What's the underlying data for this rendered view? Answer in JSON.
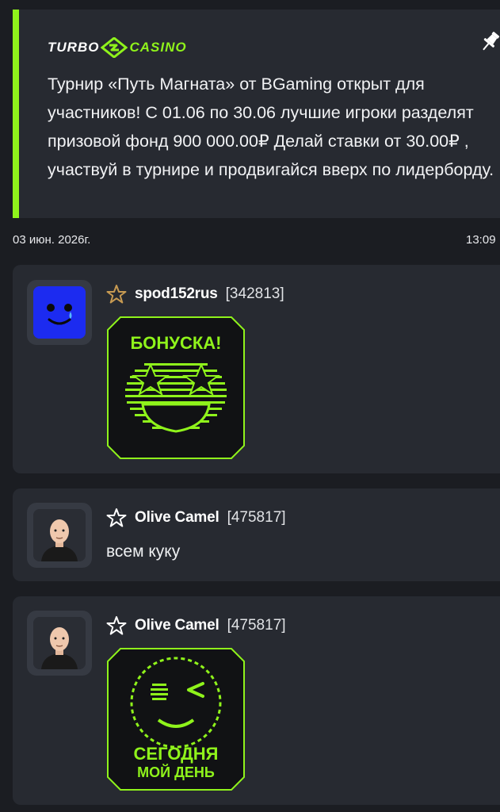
{
  "pinned": {
    "logo_left": "TURBO",
    "logo_right": "CASINO",
    "text": "Турнир «Путь Магната» от BGaming открыт для участников! С 01.06 по 30.06 лучшие игроки разделят призовой фонд 900 000.00₽ Делай ставки от 30.00₽ , участвуй в турнире и продвигайся вверх по лидерборду.",
    "pin_icon": "pin-icon"
  },
  "meta": {
    "date": "03 июн. 2026г.",
    "time": "13:09"
  },
  "messages": [
    {
      "username": "spod152rus",
      "user_id": "[342813]",
      "star_color": "#c79a52",
      "sticker_text": "БОНУСКА!"
    },
    {
      "username": "Olive Camel",
      "user_id": "[475817]",
      "text": "всем куку"
    },
    {
      "username": "Olive Camel",
      "user_id": "[475817]",
      "sticker_line1": "СЕГОДНЯ",
      "sticker_line2": "МОЙ ДЕНЬ"
    }
  ],
  "colors": {
    "accent": "#8ff31b",
    "background": "#1b1d22",
    "card": "#272a31"
  }
}
